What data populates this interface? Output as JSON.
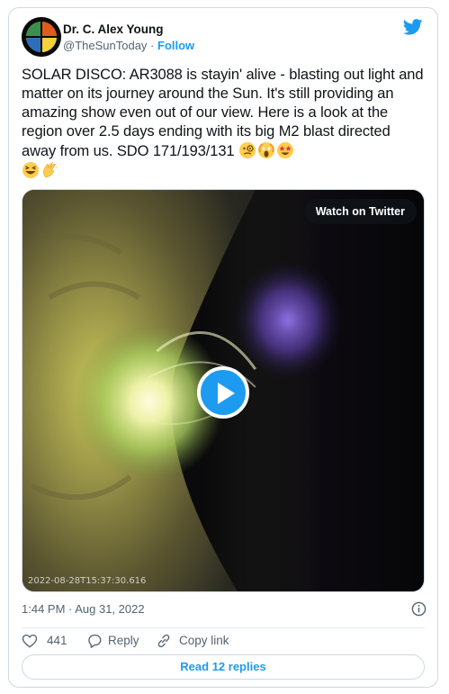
{
  "author": {
    "display_name": "Dr. C. Alex Young",
    "handle": "@TheSunToday",
    "separator": "·",
    "follow_label": "Follow"
  },
  "tweet": {
    "text": "SOLAR DISCO: AR3088 is stayin' alive - blasting out light and matter on its journey around the Sun. It's still providing an amazing show even out of our view. Here is a look at the region over 2.5 days ending with its big M2 blast directed away from us. SDO 171/193/131 ",
    "emojis_line1": [
      "face-with-monocle-emoji",
      "face-screaming-emoji",
      "star-struck-emoji"
    ],
    "emojis_line2": [
      "grinning-squinting-face-emoji",
      "clapping-hands-emoji"
    ]
  },
  "media": {
    "watch_label": "Watch on Twitter",
    "frame_timestamp": "2022-08-28T15:37:30.616"
  },
  "meta": {
    "time": "1:44 PM · Aug 31, 2022"
  },
  "actions": {
    "like_count": "441",
    "reply_label": "Reply",
    "copy_label": "Copy link"
  },
  "read_replies_label": "Read 12 replies",
  "colors": {
    "accent": "#1d9bf0",
    "text": "#0f1419",
    "muted": "#536471",
    "border": "#cfd9de"
  }
}
